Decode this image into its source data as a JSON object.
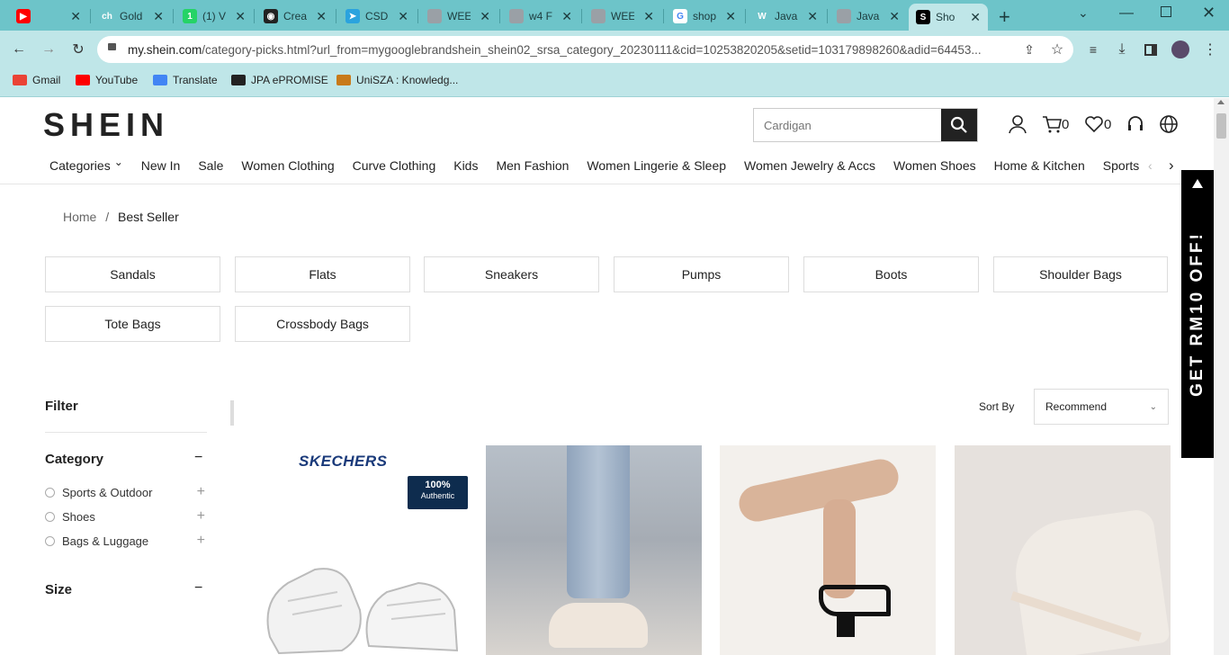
{
  "browser": {
    "tabs": [
      {
        "icon": "youtube-icon",
        "title": "",
        "color": "#ff0000",
        "favtext": "▶"
      },
      {
        "icon": "ch-icon",
        "title": "Gold",
        "color": "#6dc4c9",
        "favtext": "ch"
      },
      {
        "icon": "whatsapp-icon",
        "title": "(1) V",
        "color": "#25d366",
        "favtext": "1"
      },
      {
        "icon": "github-icon",
        "title": "Crea",
        "color": "#222222",
        "favtext": "◉"
      },
      {
        "icon": "telegram-icon",
        "title": "CSD",
        "color": "#2aa3de",
        "favtext": "➤"
      },
      {
        "icon": "globe-icon",
        "title": "WEE",
        "color": "#9aa0a6",
        "favtext": ""
      },
      {
        "icon": "globe-icon",
        "title": "w4 F",
        "color": "#9aa0a6",
        "favtext": ""
      },
      {
        "icon": "globe-icon",
        "title": "WEE",
        "color": "#9aa0a6",
        "favtext": ""
      },
      {
        "icon": "google-icon",
        "title": "shop",
        "color": "#ffffff",
        "favtext": "G"
      },
      {
        "icon": "w-icon",
        "title": "Java",
        "color": "#6dc4c9",
        "favtext": "W"
      },
      {
        "icon": "chatgpt-icon",
        "title": "Java",
        "color": "#9aa0a6",
        "favtext": ""
      },
      {
        "icon": "shein-icon",
        "title": "Sho",
        "color": "#000000",
        "favtext": "S"
      }
    ],
    "url_host": "my.shein.com",
    "url_rest": "/category-picks.html?url_from=mygooglebrandshein_shein02_srsa_category_20230111&cid=10253820205&setid=103179898260&adid=64453...",
    "bookmarks": [
      {
        "icon": "gmail-icon",
        "label": "Gmail"
      },
      {
        "icon": "youtube-icon",
        "label": "YouTube"
      },
      {
        "icon": "translate-icon",
        "label": "Translate"
      },
      {
        "icon": "jpa-icon",
        "label": "JPA ePROMISE"
      },
      {
        "icon": "uniszaicon",
        "label": "UniSZA : Knowledg..."
      }
    ]
  },
  "site": {
    "logo": "SHEIN",
    "search_placeholder": "Cardigan",
    "cart_count": "0",
    "wish_count": "0",
    "nav": [
      "Categories",
      "New In",
      "Sale",
      "Women Clothing",
      "Curve Clothing",
      "Kids",
      "Men Fashion",
      "Women Lingerie & Sleep",
      "Women Jewelry & Accs",
      "Women Shoes",
      "Home & Kitchen",
      "Sports & Outdoor"
    ],
    "breadcrumb": {
      "home": "Home",
      "sep": "/",
      "current": "Best Seller"
    },
    "chips": [
      "Sandals",
      "Flats",
      "Sneakers",
      "Pumps",
      "Boots",
      "Shoulder Bags",
      "Tote Bags",
      "Crossbody Bags"
    ],
    "filter": {
      "title": "Filter",
      "category_title": "Category",
      "options": [
        "Sports & Outdoor",
        "Shoes",
        "Bags & Luggage"
      ],
      "size_title": "Size",
      "collapse_symbol": "−"
    },
    "sort": {
      "label": "Sort By",
      "value": "Recommend"
    },
    "products": [
      {
        "brand": "SKECHERS",
        "badge": "100%",
        "badge_sub": "Authentic"
      },
      {},
      {},
      {}
    ],
    "promo": "GET RM10 OFF!"
  }
}
